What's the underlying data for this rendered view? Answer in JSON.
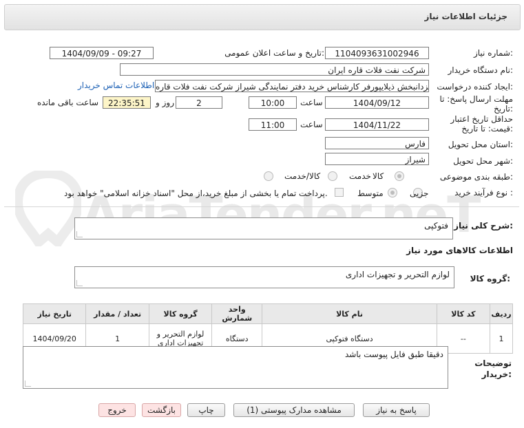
{
  "header": {
    "title": "جزئیات اطلاعات نیاز"
  },
  "watermark": {
    "text": "AriaTender.neT"
  },
  "form": {
    "need_number": {
      "label": "شماره نیاز:",
      "value": "1104093631002946"
    },
    "announce_datetime": {
      "label": "تاریخ و ساعت اعلان عمومی:",
      "value": "1404/09/09 - 09:27"
    },
    "buyer_org": {
      "label": "نام دستگاه خریدار:",
      "value": "شرکت نفت فلات قاره ایران"
    },
    "creator": {
      "label": "ایجاد کننده درخواست:",
      "value": "یزدانبخش ذیلایپورفر کارشناس خرید دفتر نمایندگی شیراز شرکت نفت فلات قاره",
      "contact_link": "اطلاعات تماس خریدار"
    },
    "deadline": {
      "label": "مهلت ارسال پاسخ: تا تاریخ:",
      "date": "1404/09/12",
      "time_label": "ساعت",
      "time": "10:00",
      "days": "2",
      "days_label": "روز و",
      "remaining": "22:35:51",
      "remaining_label": "ساعت باقی مانده"
    },
    "validity": {
      "label": "حداقل تاریخ اعتبار قیمت: تا تاریخ:",
      "date": "1404/11/22",
      "time_label": "ساعت",
      "time": "11:00"
    },
    "province": {
      "label": "استان محل تحویل:",
      "value": "فارس"
    },
    "city": {
      "label": "شهر محل تحویل:",
      "value": "شیراز"
    },
    "category": {
      "label": "طبقه بندی موضوعی:",
      "options": [
        "کالا",
        "خدمت",
        "کالا/خدمت"
      ],
      "selected": "کالا"
    },
    "purchase_type": {
      "label": "نوع فرآیند خرید :",
      "options": [
        "جزیی",
        "متوسط"
      ],
      "selected": "جزیی",
      "treasury_note": "پرداخت تمام یا بخشی از مبلغ خرید،از محل \"اسناد خزانه اسلامی\" خواهد بود."
    }
  },
  "summary": {
    "label": "شرح کلی نیاز:",
    "value": "فتوکپی"
  },
  "goods_info": {
    "section_title": "اطلاعات کالاهای مورد نیاز",
    "group_label": "گروه کالا:",
    "group_value": "لوازم التحریر و تجهیزات اداری"
  },
  "table": {
    "headers": [
      "ردیف",
      "کد کالا",
      "نام کالا",
      "واحد شمارش",
      "گروه کالا",
      "تعداد / مقدار",
      "تاریخ نیاز"
    ],
    "rows": [
      {
        "row": "1",
        "code": "--",
        "name": "دستگاه فتوکپی",
        "unit": "دستگاه",
        "group": "لوازم التحریر و تجهیزات اداری",
        "qty": "1",
        "date": "1404/09/20"
      }
    ]
  },
  "buyer_notes": {
    "label": "توضیحات خریدار:",
    "value": "دقیقا طبق فایل پیوست باشد"
  },
  "buttons": {
    "reply": "پاسخ به نیاز",
    "attachments": "مشاهده مدارک پیوستی (1)",
    "print": "چاپ",
    "back": "بازگشت",
    "exit": "خروج"
  }
}
